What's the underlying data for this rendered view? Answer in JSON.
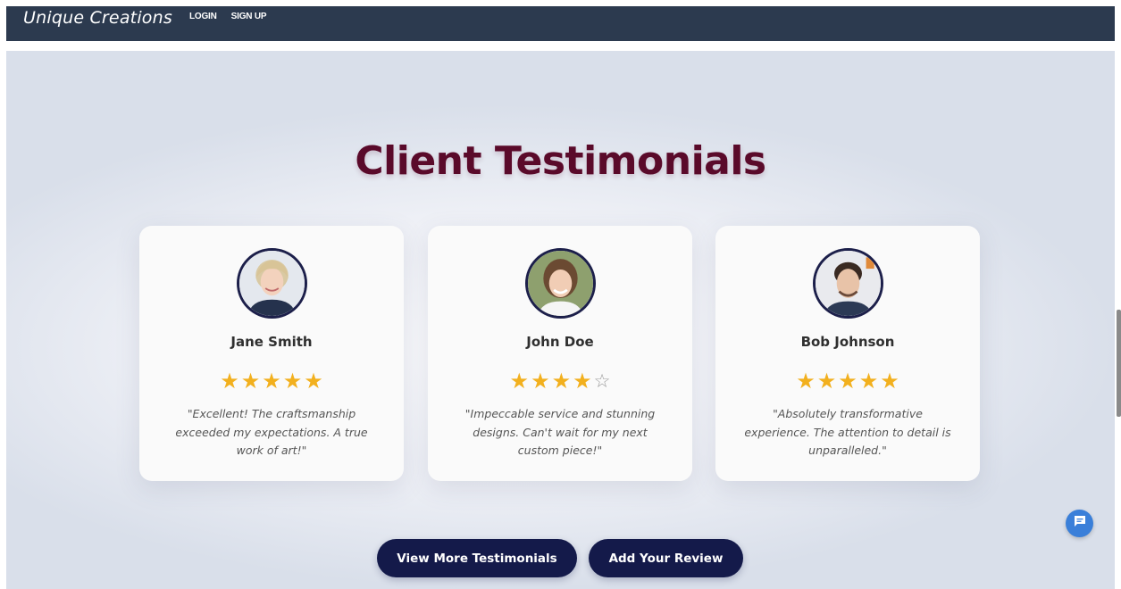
{
  "nav": {
    "brand": "Unique Creations",
    "links": [
      "LOGIN",
      "SIGN UP"
    ]
  },
  "section": {
    "title": "Client Testimonials"
  },
  "testimonials": [
    {
      "name": "Jane Smith",
      "rating": 5,
      "max_rating": 5,
      "quote": "\"Excellent! The craftsmanship exceeded my expectations. A true work of art!\""
    },
    {
      "name": "John Doe",
      "rating": 4,
      "max_rating": 5,
      "quote": "\"Impeccable service and stunning designs. Can't wait for my next custom piece!\""
    },
    {
      "name": "Bob Johnson",
      "rating": 5,
      "max_rating": 5,
      "quote": "\"Absolutely transformative experience. The attention to detail is unparalleled.\""
    }
  ],
  "buttons": {
    "view_more": "View More Testimonials",
    "add_review": "Add Your Review"
  },
  "colors": {
    "navbar": "#2c3a4f",
    "title": "#5a0a2a",
    "button": "#141a4a",
    "star": "#f2b01e",
    "chat_button": "#3a7fd9"
  },
  "icons": {
    "chat": "chat-bubble-icon",
    "star_full": "star-filled-icon",
    "star_empty": "star-outline-icon"
  }
}
